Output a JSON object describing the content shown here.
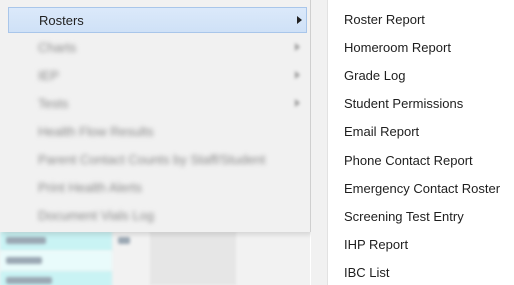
{
  "main_menu": {
    "items": [
      {
        "label": "Rosters",
        "has_submenu": true,
        "state": "active"
      },
      {
        "label": "Charts",
        "has_submenu": true,
        "state": "obscured"
      },
      {
        "label": "IEP",
        "has_submenu": true,
        "state": "obscured"
      },
      {
        "label": "Tests",
        "has_submenu": true,
        "state": "obscured"
      },
      {
        "label": "Health Flow Results",
        "has_submenu": false,
        "state": "obscured"
      },
      {
        "label": "Parent Contact Counts by Staff/Student",
        "has_submenu": false,
        "state": "obscured"
      },
      {
        "label": "Print Health Alerts",
        "has_submenu": false,
        "state": "obscured"
      },
      {
        "label": "Document Vials Log",
        "has_submenu": false,
        "state": "obscured"
      }
    ]
  },
  "sub_menu": {
    "items": [
      {
        "label": "Roster Report"
      },
      {
        "label": "Homeroom Report"
      },
      {
        "label": "Grade Log"
      },
      {
        "label": "Student Permissions"
      },
      {
        "label": "Email Report"
      },
      {
        "label": "Phone Contact Report"
      },
      {
        "label": "Emergency Contact Roster"
      },
      {
        "label": "Screening Test Entry"
      },
      {
        "label": "IHP Report"
      },
      {
        "label": "IBC List"
      }
    ]
  },
  "colors": {
    "active_bg": "#d5e5f9",
    "active_border": "#a9c6ea",
    "menu_bg": "#f1f1f1",
    "text": "#1e1e1e"
  }
}
